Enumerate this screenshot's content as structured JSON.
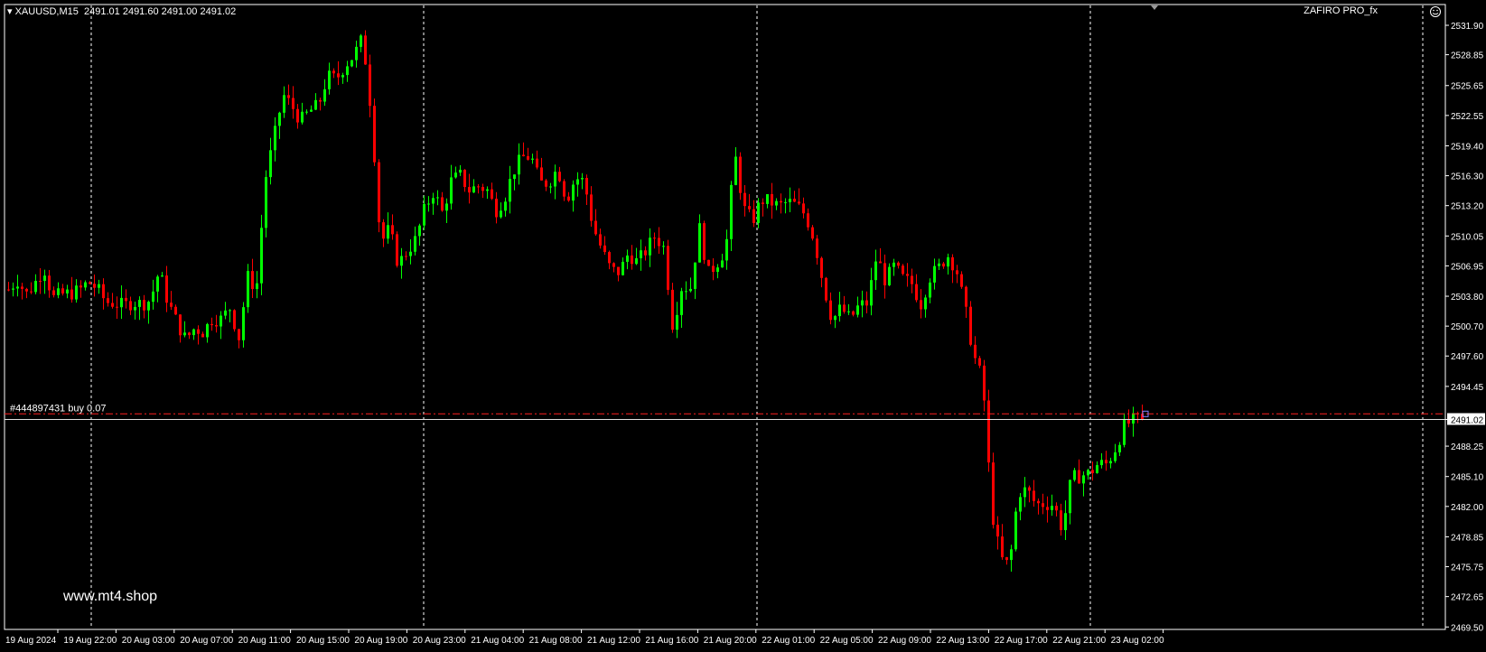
{
  "header": {
    "symbol": "XAUUSD,M15",
    "ohlc": "2491.01 2491.60 2491.00 2491.02",
    "indicator": "ZAFIRO PRO_fx"
  },
  "order_label": "#444897431 buy 0.07",
  "watermark": "www.mt4.shop",
  "colors": {
    "background": "#000000",
    "bull": "#00ff00",
    "bear": "#ff0000",
    "grid": "#ffffff",
    "order_line": "#ff0000",
    "price_line": "#ffffff"
  },
  "chart_data": {
    "type": "candlestick",
    "ylim": [
      2469.9,
      2533.4
    ],
    "current_price": 2491.02,
    "order_price": 2491.6,
    "y_ticks": [
      "2531.90",
      "2528.85",
      "2525.65",
      "2522.55",
      "2519.40",
      "2516.30",
      "2513.20",
      "2510.05",
      "2506.95",
      "2503.80",
      "2500.70",
      "2497.60",
      "2494.45",
      "2491.02",
      "2488.25",
      "2485.10",
      "2482.00",
      "2478.85",
      "2475.75",
      "2472.65",
      "2469.50"
    ],
    "x_ticks": [
      "19 Aug 2024",
      "19 Aug 22:00",
      "20 Aug 03:00",
      "20 Aug 07:00",
      "20 Aug 11:00",
      "20 Aug 15:00",
      "20 Aug 19:00",
      "20 Aug 23:00",
      "21 Aug 04:00",
      "21 Aug 08:00",
      "21 Aug 12:00",
      "21 Aug 16:00",
      "21 Aug 20:00",
      "22 Aug 01:00",
      "22 Aug 05:00",
      "22 Aug 09:00",
      "22 Aug 13:00",
      "22 Aug 17:00",
      "22 Aug 21:00",
      "23 Aug 02:00"
    ],
    "close_path": [
      2504.5,
      2505.5,
      2504.0,
      2505.2,
      2506.8,
      2503.6,
      2504.0,
      2504.1,
      2504.4,
      2505.3,
      2504.6,
      2503.2,
      2503.1,
      2502.8,
      2503.2,
      2503.0,
      2503.4,
      2506.4,
      2503.2,
      2501.1,
      2499.3,
      2500.5,
      2500.1,
      2501.5,
      2501.4,
      2502.6,
      2499.5,
      2505.8,
      2504.6,
      2516.0,
      2520.3,
      2524.7,
      2523.5,
      2522.0,
      2523.0,
      2523.6,
      2526.6,
      2526.3,
      2527.8,
      2528.8,
      2530.6,
      2522.5,
      2509.3,
      2510.8,
      2507.1,
      2508.5,
      2509.7,
      2512.9,
      2514.7,
      2512.4,
      2515.8,
      2516.3,
      2514.8,
      2515.2,
      2514.9,
      2512.7,
      2514.0,
      2516.8,
      2518.2,
      2518.3,
      2515.5,
      2515.6,
      2517.1,
      2513.8,
      2516.1,
      2515.7,
      2511.0,
      2508.6,
      2506.5,
      2506.3,
      2508.3,
      2507.3,
      2508.6,
      2510.1,
      2508.8,
      2500.7,
      2504.8,
      2504.7,
      2510.9,
      2506.1,
      2507.3,
      2508.8,
      2518.6,
      2512.9,
      2511.6,
      2513.8,
      2513.6,
      2513.1,
      2513.6,
      2513.2,
      2512.2,
      2509.6,
      2505.0,
      2501.3,
      2502.6,
      2501.4,
      2502.8,
      2503.1,
      2508.0,
      2505.4,
      2506.9,
      2505.6,
      2505.1,
      2503.0,
      2505.8,
      2506.7,
      2508.1,
      2506.7,
      2502.5,
      2497.6,
      2495.0,
      2481.6,
      2476.6,
      2475.8,
      2483.5,
      2483.7,
      2482.2,
      2482.3,
      2482.2,
      2479.6,
      2484.9,
      2485.2,
      2485.4,
      2486.4,
      2486.4,
      2488.1,
      2490.4,
      2490.9,
      2491.02
    ]
  }
}
